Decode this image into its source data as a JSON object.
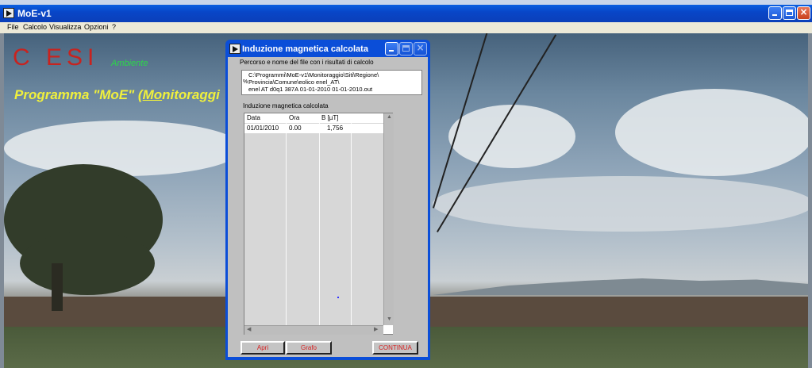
{
  "window": {
    "title": "MoE-v1",
    "menu": [
      "File",
      "Calcolo",
      "Visualizza",
      "Opzioni",
      "?"
    ]
  },
  "background": {
    "logo_text": "C ESI",
    "logo_subtext": "Ambiente",
    "program_prefix": "Programma \"MoE\"  (",
    "program_underlined": "Mo",
    "program_suffix": "nitoraggi"
  },
  "dialog": {
    "title": "Induzione magnetica calcolata",
    "path_label": "Percorso e nome del file con i risultati di calcolo",
    "path_prefix": "%",
    "path_lines": [
      "C:\\Programmi\\MoE-v1\\Monitoraggio\\Siti\\Regione\\",
      "Provincia\\Comune\\eolico enel_AT\\",
      "enel  AT  d0q1  387A  01-01-2010  01-01-2010.out"
    ],
    "table_label": "Induzione magnetica calcolata",
    "table": {
      "headers": [
        "Data",
        "Ora",
        "B [µT]"
      ],
      "rows": [
        [
          "01/01/2010",
          "0.00",
          "1,756"
        ]
      ]
    },
    "buttons": {
      "apri": "Apri",
      "grafo": "Grafo",
      "continua": "CONTINUA"
    }
  },
  "colors": {
    "titlebar": "#0b4ed8",
    "logo": "#c8231f",
    "subtext": "#2dd64a",
    "program_text": "#f0f03c",
    "button_text": "#d71e1e"
  }
}
